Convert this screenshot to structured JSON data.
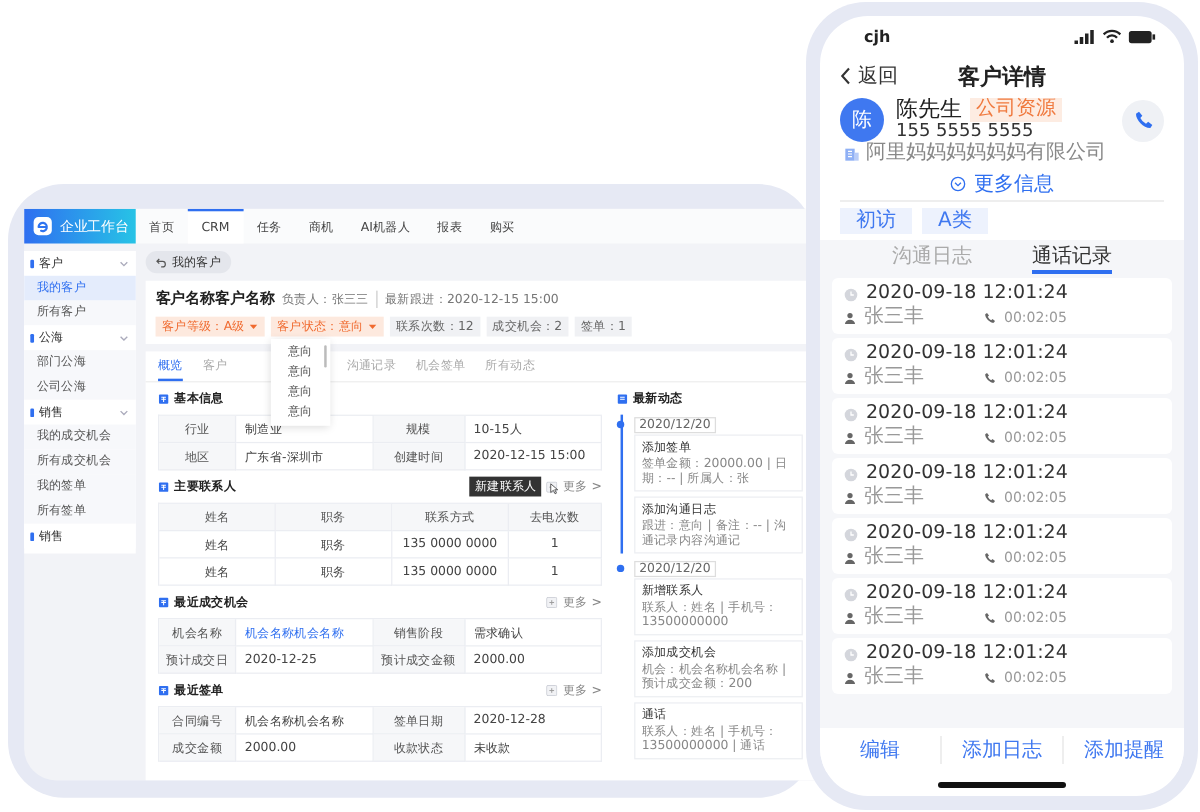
{
  "desktop": {
    "app_name": "企业工作台",
    "nav_tabs": [
      {
        "label": "首页",
        "selected": false
      },
      {
        "label": "CRM",
        "selected": true
      },
      {
        "label": "任务",
        "selected": false
      },
      {
        "label": "商机",
        "selected": false
      },
      {
        "label": "AI机器人",
        "selected": false
      },
      {
        "label": "报表",
        "selected": false
      },
      {
        "label": "购买",
        "selected": false
      }
    ],
    "sidebar": [
      {
        "label": "客户",
        "children": [
          {
            "label": "我的客户",
            "selected": true
          },
          {
            "label": "所有客户",
            "selected": false
          }
        ]
      },
      {
        "label": "公海",
        "children": [
          {
            "label": "部门公海",
            "selected": false
          },
          {
            "label": "公司公海",
            "selected": false
          }
        ]
      },
      {
        "label": "销售",
        "children": [
          {
            "label": "我的成交机会",
            "selected": false
          },
          {
            "label": "所有成交机会",
            "selected": false
          },
          {
            "label": "我的签单",
            "selected": false
          },
          {
            "label": "所有签单",
            "selected": false
          }
        ]
      },
      {
        "label": "销售"
      }
    ],
    "breadcrumb": "我的客户",
    "customer": {
      "name": "客户名称客户名称",
      "owner": "负责人：张三三",
      "latest": "最新跟进：2020-12-15 15:00"
    },
    "tags": [
      {
        "label": "客户等级：A级",
        "kind": "dropdown"
      },
      {
        "label": "客户状态：意向",
        "kind": "dropdown"
      },
      {
        "label": "联系次数：12",
        "kind": "stat"
      },
      {
        "label": "成交机会：2",
        "kind": "stat"
      },
      {
        "label": "签单：1",
        "kind": "stat"
      }
    ],
    "dropdown_options": [
      "意向",
      "意向",
      "意向",
      "意向"
    ],
    "tabs": [
      {
        "label": "概览",
        "selected": true
      },
      {
        "label": "客户",
        "selected": false
      },
      {
        "label": "沟通记录",
        "selected": false
      },
      {
        "label": "机会签单",
        "selected": false
      },
      {
        "label": "所有动态",
        "selected": false
      }
    ],
    "sections": [
      {
        "kind": "fields",
        "title": "基本信息",
        "rows": [
          [
            {
              "label": "行业",
              "value": "制造业",
              "link": false
            },
            {
              "label": "规模",
              "value": "10-15人",
              "link": false
            }
          ],
          [
            {
              "label": "地区",
              "value": "广东省-深圳市",
              "link": false
            },
            {
              "label": "创建时间",
              "value": "2020-12-15 15:00",
              "link": false
            }
          ]
        ]
      },
      {
        "kind": "table",
        "title": "主要联系人",
        "more": "更多 >",
        "tooltip": "新建联系人",
        "columns": [
          "姓名",
          "职务",
          "联系方式",
          "去电次数"
        ],
        "rows": [
          [
            "姓名",
            "职务",
            "135 0000 0000",
            "1"
          ],
          [
            "姓名",
            "职务",
            "135 0000 0000",
            "1"
          ]
        ]
      },
      {
        "kind": "fields",
        "title": "最近成交机会",
        "more": "更多 >",
        "rows": [
          [
            {
              "label": "机会名称",
              "value": "机会名称机会名称",
              "link": true
            },
            {
              "label": "销售阶段",
              "value": "需求确认",
              "link": false
            }
          ],
          [
            {
              "label": "预计成交日",
              "value": "2020-12-25",
              "link": false
            },
            {
              "label": "预计成交金额",
              "value": "2000.00",
              "link": false
            }
          ]
        ]
      },
      {
        "kind": "fields",
        "title": "最近签单",
        "more": "更多 >",
        "rows": [
          [
            {
              "label": "合同编号",
              "value": "机会名称机会名称",
              "link": false
            },
            {
              "label": "签单日期",
              "value": "2020-12-28",
              "link": false
            }
          ],
          [
            {
              "label": "成交金额",
              "value": "2000.00",
              "link": false
            },
            {
              "label": "收款状态",
              "value": "未收款",
              "link": false
            }
          ]
        ]
      }
    ],
    "timeline": {
      "title": "最新动态",
      "groups": [
        {
          "date": "2020/12/20",
          "items": [
            {
              "title": "添加签单",
              "detail": "签单金额：20000.00 | 日期：-- | 所属人：张"
            },
            {
              "title": "添加沟通日志",
              "detail": "跟进：意向 | 备注：-- | 沟通记录内容沟通记"
            }
          ]
        },
        {
          "date": "2020/12/20",
          "items": [
            {
              "title": "新增联系人",
              "detail": "联系人：姓名 | 手机号：13500000000"
            },
            {
              "title": "添加成交机会",
              "detail": "机会：机会名称机会名称 | 预计成交金额：200"
            },
            {
              "title": "通话",
              "detail": "联系人：姓名 | 手机号：13500000000 | 通话"
            }
          ]
        }
      ]
    }
  },
  "phone": {
    "carrier": "cjh",
    "back": "返回",
    "title": "客户详情",
    "contact": {
      "avatar": "陈",
      "name": "陈先生",
      "badge": "公司资源",
      "phone": "155 5555 5555",
      "company": "阿里妈妈妈妈妈妈有限公司"
    },
    "more_info": "更多信息",
    "tags": [
      "初访",
      "A类"
    ],
    "tabs": [
      {
        "label": "沟通日志",
        "selected": false
      },
      {
        "label": "通话记录",
        "selected": true
      }
    ],
    "calls": [
      {
        "time": "2020-09-18 12:01:24",
        "person": "张三丰",
        "duration": "00:02:05"
      },
      {
        "time": "2020-09-18 12:01:24",
        "person": "张三丰",
        "duration": "00:02:05"
      },
      {
        "time": "2020-09-18 12:01:24",
        "person": "张三丰",
        "duration": "00:02:05"
      },
      {
        "time": "2020-09-18 12:01:24",
        "person": "张三丰",
        "duration": "00:02:05"
      },
      {
        "time": "2020-09-18 12:01:24",
        "person": "张三丰",
        "duration": "00:02:05"
      },
      {
        "time": "2020-09-18 12:01:24",
        "person": "张三丰",
        "duration": "00:02:05"
      },
      {
        "time": "2020-09-18 12:01:24",
        "person": "张三丰",
        "duration": "00:02:05"
      }
    ],
    "actions": [
      "编辑",
      "添加日志",
      "添加提醒"
    ]
  }
}
